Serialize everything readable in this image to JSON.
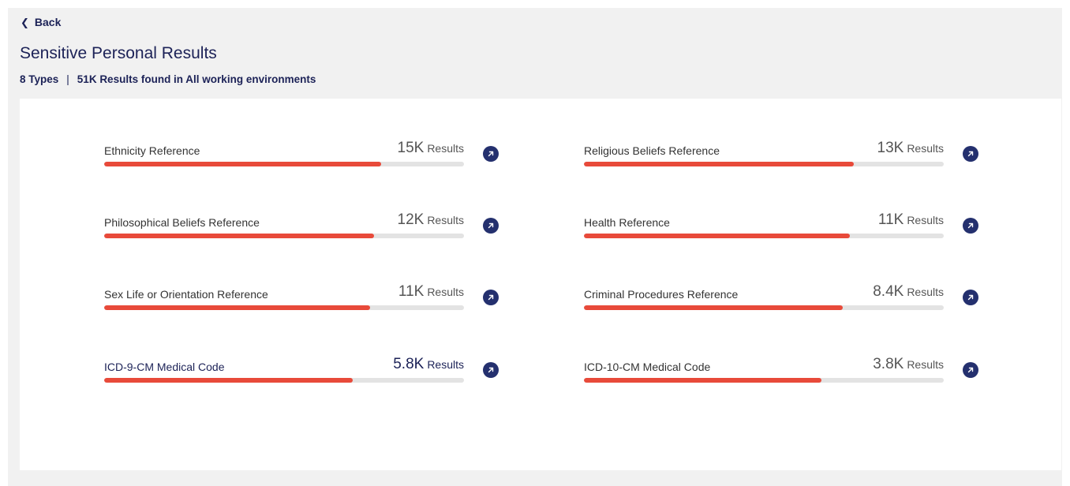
{
  "nav": {
    "back_label": "Back"
  },
  "header": {
    "title": "Sensitive Personal Results",
    "types": "8 Types",
    "separator": "|",
    "results_summary": "51K Results found in All working environments"
  },
  "colors": {
    "bar_fill": "#e84a3a",
    "bar_track": "#e3e3e3",
    "accent_navy": "#24306e"
  },
  "items": [
    {
      "label": "Ethnicity Reference",
      "count": "15K",
      "unit": "Results",
      "level": 0.77
    },
    {
      "label": "Religious Beliefs Reference",
      "count": "13K",
      "unit": "Results",
      "level": 0.75
    },
    {
      "label": "Philosophical Beliefs Reference",
      "count": "12K",
      "unit": "Results",
      "level": 0.75
    },
    {
      "label": "Health Reference",
      "count": "11K",
      "unit": "Results",
      "level": 0.74
    },
    {
      "label": "Sex Life or Orientation Reference",
      "count": "11K",
      "unit": "Results",
      "level": 0.74
    },
    {
      "label": "Criminal Procedures Reference",
      "count": "8.4K",
      "unit": "Results",
      "level": 0.72
    },
    {
      "label": "ICD-9-CM Medical Code",
      "count": "5.8K",
      "unit": "Results",
      "level": 0.69
    },
    {
      "label": "ICD-10-CM Medical Code",
      "count": "3.8K",
      "unit": "Results",
      "level": 0.66
    }
  ]
}
